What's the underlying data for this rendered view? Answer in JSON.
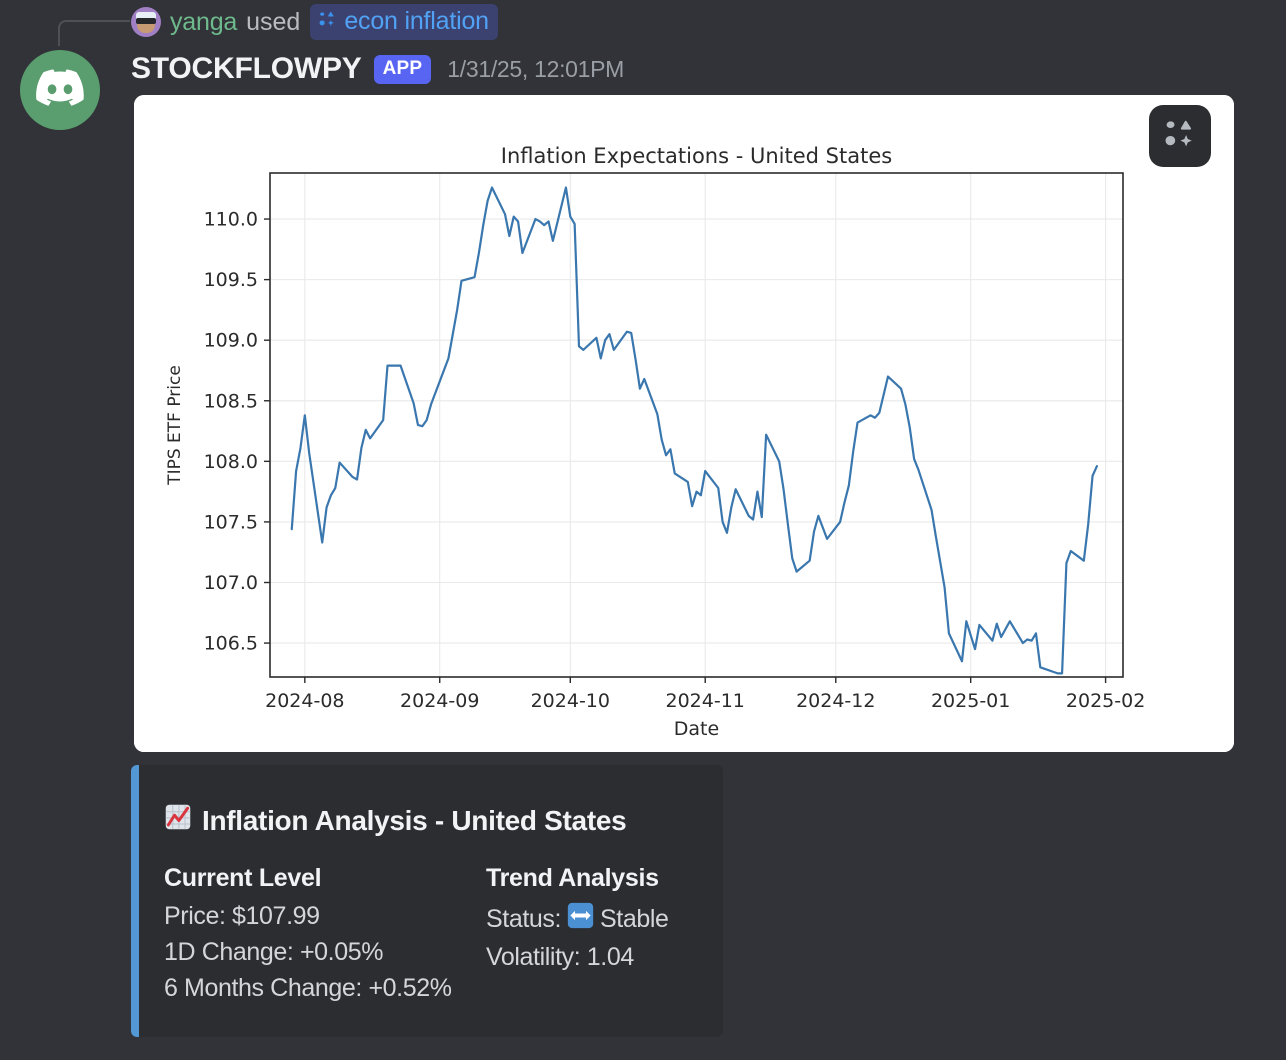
{
  "command_header": {
    "username": "yanga",
    "used_text": "used",
    "command_name": "econ inflation",
    "apps_icon": "apps-icon"
  },
  "message": {
    "author": "STOCKFLOWPY",
    "app_tag": "APP",
    "timestamp": "1/31/25, 12:01PM",
    "avatar_icon": "discord-logo-icon"
  },
  "chart_card": {
    "apps_badge_icon": "apps-icon"
  },
  "embed": {
    "accent_color": "#5398d4",
    "title_emoji": "chart-increasing-emoji",
    "title": "Inflation Analysis - United States",
    "fields": [
      {
        "name": "Current Level",
        "lines": [
          "Price: $107.99",
          "1D Change: +0.05%",
          "6 Months Change: +0.52%"
        ]
      },
      {
        "name": "Trend Analysis",
        "status_label": "Status:",
        "status_emoji": "left-right-arrow-emoji",
        "status_value": "Stable",
        "lines": [
          "Volatility: 1.04"
        ]
      }
    ]
  },
  "chart_data": {
    "type": "line",
    "title": "Inflation Expectations - United States",
    "xlabel": "Date",
    "ylabel": "TIPS ETF Price",
    "line_color": "#3a77ae",
    "grid": true,
    "legend": null,
    "ylim": [
      106.22,
      110.38
    ],
    "yticks": [
      106.5,
      107.0,
      107.5,
      108.0,
      108.5,
      109.0,
      109.5,
      110.0
    ],
    "ytick_labels": [
      "106.5",
      "107.0",
      "107.5",
      "108.0",
      "108.5",
      "109.0",
      "109.5",
      "110.0"
    ],
    "xticks": [
      "2024-08",
      "2024-09",
      "2024-10",
      "2024-11",
      "2024-12",
      "2025-01",
      "2025-02"
    ],
    "xlim": [
      "2024-07-24",
      "2025-02-05"
    ],
    "series": [
      {
        "name": "TIPS ETF Price",
        "x": [
          "2024-07-29",
          "2024-07-30",
          "2024-07-31",
          "2024-08-01",
          "2024-08-02",
          "2024-08-05",
          "2024-08-06",
          "2024-08-07",
          "2024-08-08",
          "2024-08-09",
          "2024-08-12",
          "2024-08-13",
          "2024-08-14",
          "2024-08-15",
          "2024-08-16",
          "2024-08-19",
          "2024-08-20",
          "2024-08-21",
          "2024-08-22",
          "2024-08-23",
          "2024-08-26",
          "2024-08-27",
          "2024-08-28",
          "2024-08-29",
          "2024-08-30",
          "2024-09-03",
          "2024-09-04",
          "2024-09-05",
          "2024-09-06",
          "2024-09-09",
          "2024-09-10",
          "2024-09-11",
          "2024-09-12",
          "2024-09-13",
          "2024-09-16",
          "2024-09-17",
          "2024-09-18",
          "2024-09-19",
          "2024-09-20",
          "2024-09-23",
          "2024-09-24",
          "2024-09-25",
          "2024-09-26",
          "2024-09-27",
          "2024-09-30",
          "2024-10-01",
          "2024-10-02",
          "2024-10-03",
          "2024-10-04",
          "2024-10-07",
          "2024-10-08",
          "2024-10-09",
          "2024-10-10",
          "2024-10-11",
          "2024-10-14",
          "2024-10-15",
          "2024-10-16",
          "2024-10-17",
          "2024-10-18",
          "2024-10-21",
          "2024-10-22",
          "2024-10-23",
          "2024-10-24",
          "2024-10-25",
          "2024-10-28",
          "2024-10-29",
          "2024-10-30",
          "2024-10-31",
          "2024-11-01",
          "2024-11-04",
          "2024-11-05",
          "2024-11-06",
          "2024-11-07",
          "2024-11-08",
          "2024-11-11",
          "2024-11-12",
          "2024-11-13",
          "2024-11-14",
          "2024-11-15",
          "2024-11-18",
          "2024-11-19",
          "2024-11-20",
          "2024-11-21",
          "2024-11-22",
          "2024-11-25",
          "2024-11-26",
          "2024-11-27",
          "2024-11-29",
          "2024-12-02",
          "2024-12-03",
          "2024-12-04",
          "2024-12-05",
          "2024-12-06",
          "2024-12-09",
          "2024-12-10",
          "2024-12-11",
          "2024-12-12",
          "2024-12-13",
          "2024-12-16",
          "2024-12-17",
          "2024-12-18",
          "2024-12-19",
          "2024-12-20",
          "2024-12-23",
          "2024-12-24",
          "2024-12-26",
          "2024-12-27",
          "2024-12-30",
          "2024-12-31",
          "2025-01-02",
          "2025-01-03",
          "2025-01-06",
          "2025-01-07",
          "2025-01-08",
          "2025-01-10",
          "2025-01-13",
          "2025-01-14",
          "2025-01-15",
          "2025-01-16",
          "2025-01-17",
          "2025-01-21",
          "2025-01-22",
          "2025-01-23",
          "2025-01-24",
          "2025-01-27",
          "2025-01-28",
          "2025-01-29",
          "2025-01-30"
        ],
        "y": [
          107.44,
          107.92,
          108.11,
          108.38,
          108.07,
          107.33,
          107.62,
          107.72,
          107.78,
          107.99,
          107.87,
          107.85,
          108.11,
          108.26,
          108.19,
          108.34,
          108.79,
          108.79,
          108.79,
          108.79,
          108.48,
          108.3,
          108.29,
          108.34,
          108.47,
          108.85,
          109.05,
          109.25,
          109.49,
          109.52,
          109.72,
          109.95,
          110.15,
          110.26,
          110.04,
          109.86,
          110.02,
          109.98,
          109.72,
          110.0,
          109.98,
          109.95,
          109.98,
          109.82,
          110.26,
          110.02,
          109.96,
          108.95,
          108.92,
          109.02,
          108.85,
          109.0,
          109.05,
          108.92,
          109.07,
          109.06,
          108.84,
          108.6,
          108.68,
          108.39,
          108.18,
          108.05,
          108.1,
          107.9,
          107.83,
          107.63,
          107.75,
          107.72,
          107.92,
          107.78,
          107.5,
          107.41,
          107.62,
          107.77,
          107.55,
          107.52,
          107.75,
          107.54,
          108.22,
          108.0,
          107.77,
          107.48,
          107.2,
          107.09,
          107.18,
          107.42,
          107.55,
          107.36,
          107.5,
          107.66,
          107.8,
          108.08,
          108.32,
          108.38,
          108.36,
          108.4,
          108.55,
          108.7,
          108.6,
          108.47,
          108.28,
          108.02,
          107.93,
          107.6,
          107.38,
          106.96,
          106.58,
          106.35,
          106.68,
          106.45,
          106.65,
          106.52,
          106.66,
          106.55,
          106.68,
          106.5,
          106.53,
          106.52,
          106.58,
          106.3,
          106.25,
          106.25,
          107.16,
          107.26,
          107.18,
          107.48,
          107.88,
          107.96
        ]
      }
    ]
  }
}
